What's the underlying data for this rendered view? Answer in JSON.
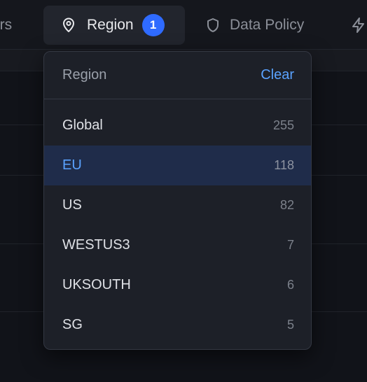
{
  "filter_bar": {
    "tabs": [
      {
        "label": "ers",
        "icon": "none"
      },
      {
        "label": "Region",
        "icon": "location-pin-icon",
        "badge": "1",
        "active": true
      },
      {
        "label": "Data Policy",
        "icon": "shield-icon"
      },
      {
        "label": "",
        "icon": "lightning-bolt-icon"
      }
    ]
  },
  "dropdown": {
    "title": "Region",
    "clear_label": "Clear",
    "items": [
      {
        "label": "Global",
        "count": "255",
        "selected": false
      },
      {
        "label": "EU",
        "count": "118",
        "selected": true
      },
      {
        "label": "US",
        "count": "82",
        "selected": false
      },
      {
        "label": "WESTUS3",
        "count": "7",
        "selected": false
      },
      {
        "label": "UKSOUTH",
        "count": "6",
        "selected": false
      },
      {
        "label": "SG",
        "count": "5",
        "selected": false
      }
    ]
  },
  "colors": {
    "accent": "#2f6bff",
    "link": "#5aa2ff",
    "panel": "#1d2028",
    "selected_row": "#1f2c4a"
  }
}
